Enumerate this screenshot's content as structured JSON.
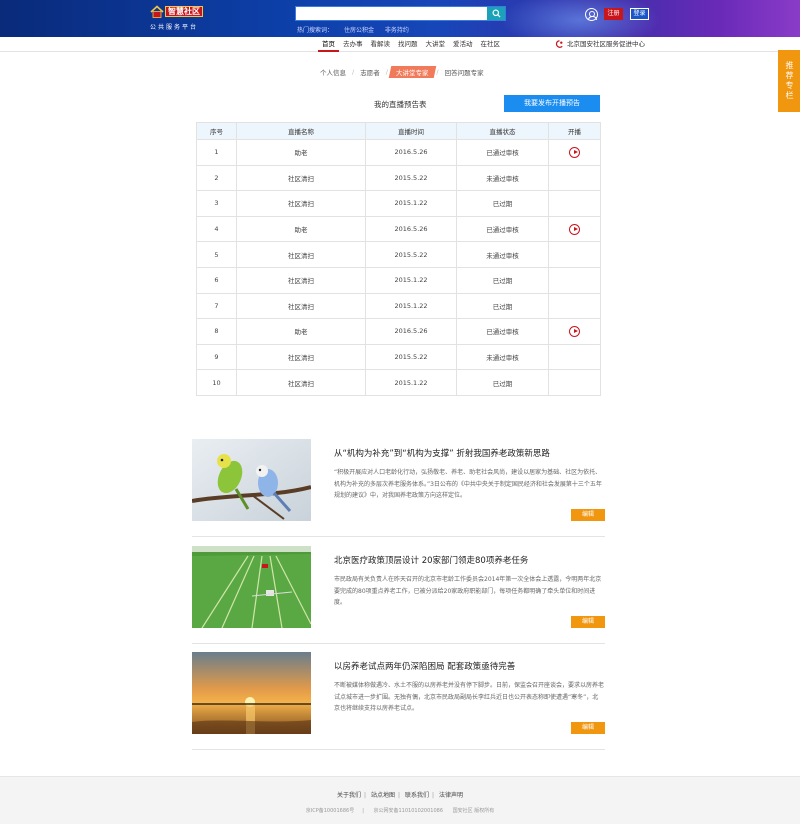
{
  "header": {
    "brand": "智慧社区",
    "subtitle": "公共服务平台",
    "search_placeholder": "",
    "hot_label": "热门搜索词：",
    "hot_words": [
      "住房公积金",
      "非务持约"
    ],
    "register": "注册",
    "login": "登录"
  },
  "nav": {
    "items": [
      "首页",
      "去办事",
      "看解读",
      "找问题",
      "大讲堂",
      "爱活动",
      "在社区"
    ],
    "org": "北京国安社区服务促进中心"
  },
  "sidetab": "推荐专栏",
  "breadcrumb": [
    "个人信息",
    "志愿者",
    "大讲堂专家",
    "回答问题专家"
  ],
  "section_title": "我的直播预告表",
  "publish_button": "我要发布开播预告",
  "table": {
    "headers": [
      "序号",
      "直播名称",
      "直播时间",
      "直播状态",
      "开播"
    ],
    "rows": [
      {
        "no": "1",
        "name": "助老",
        "time": "2016.5.26",
        "status": "已通过审核",
        "kind": "ok",
        "play": true
      },
      {
        "no": "2",
        "name": "社区清扫",
        "time": "2015.5.22",
        "status": "未通过审核",
        "kind": "fail",
        "play": false
      },
      {
        "no": "3",
        "name": "社区清扫",
        "time": "2015.1.22",
        "status": "已过期",
        "kind": "exp",
        "play": false
      },
      {
        "no": "4",
        "name": "助老",
        "time": "2016.5.26",
        "status": "已通过审核",
        "kind": "ok",
        "play": true
      },
      {
        "no": "5",
        "name": "社区清扫",
        "time": "2015.5.22",
        "status": "未通过审核",
        "kind": "fail",
        "play": false
      },
      {
        "no": "6",
        "name": "社区清扫",
        "time": "2015.1.22",
        "status": "已过期",
        "kind": "exp",
        "play": false
      },
      {
        "no": "7",
        "name": "社区清扫",
        "time": "2015.1.22",
        "status": "已过期",
        "kind": "exp",
        "play": false
      },
      {
        "no": "8",
        "name": "助老",
        "time": "2016.5.26",
        "status": "已通过审核",
        "kind": "ok",
        "play": true
      },
      {
        "no": "9",
        "name": "社区清扫",
        "time": "2015.5.22",
        "status": "未通过审核",
        "kind": "fail",
        "play": false
      },
      {
        "no": "10",
        "name": "社区清扫",
        "time": "2015.1.22",
        "status": "已过期",
        "kind": "exp",
        "play": false
      }
    ]
  },
  "news": [
    {
      "title": "从“机构为补充”到“机构为支撑” 折射我国养老政策新思路",
      "desc": "“积极开展应对人口老龄化行动，弘扬敬老、养老、助老社会风尚，建设以居家为基础、社区为依托、机构为补充的多层次养老服务体系。”3日公布的《中共中央关于制定国民经济和社会发展第十三个五年规划的建议》中，对我国养老政策方向这样定位。",
      "edit": "编辑",
      "image": "parrots"
    },
    {
      "title": "北京医疗政策顶层设计 20家部门领走80项养老任务",
      "desc": "市民政局有关负责人在昨天召开的北京市老龄工作委员会2014年第一次全体会上透露，今明两年北京要完成的80项重点养老工作，已被分派给20家政府职能部门，每项任务都明确了牵头单位和时间进度。",
      "edit": "编辑",
      "image": "farmland"
    },
    {
      "title": "以房养老试点两年仍深陷困局 配套政策亟待完善",
      "desc": "不断被媒体称做遇冷、水土不服的以房养老并没有停下脚步。日前，保监会召开座谈会，要求以房养老试点城市进一步扩围。无独有偶，北京市民政局副局长李红兵近日也公开表态称即使遭遇“寒冬”，北京也将继续支持以房养老试点。",
      "edit": "编辑",
      "image": "sunset"
    }
  ],
  "footer": {
    "links": [
      "关于我们",
      "站点地图",
      "联系我们",
      "法律声明"
    ],
    "copy": [
      "京ICP备10001686号",
      "京公网安备11010102001086",
      "国安社区 版权所有"
    ]
  },
  "colors": {
    "accent_red": "#c8161d",
    "blue_button": "#1b8cf0",
    "orange": "#f0960f",
    "fail_red": "#e0262b"
  }
}
